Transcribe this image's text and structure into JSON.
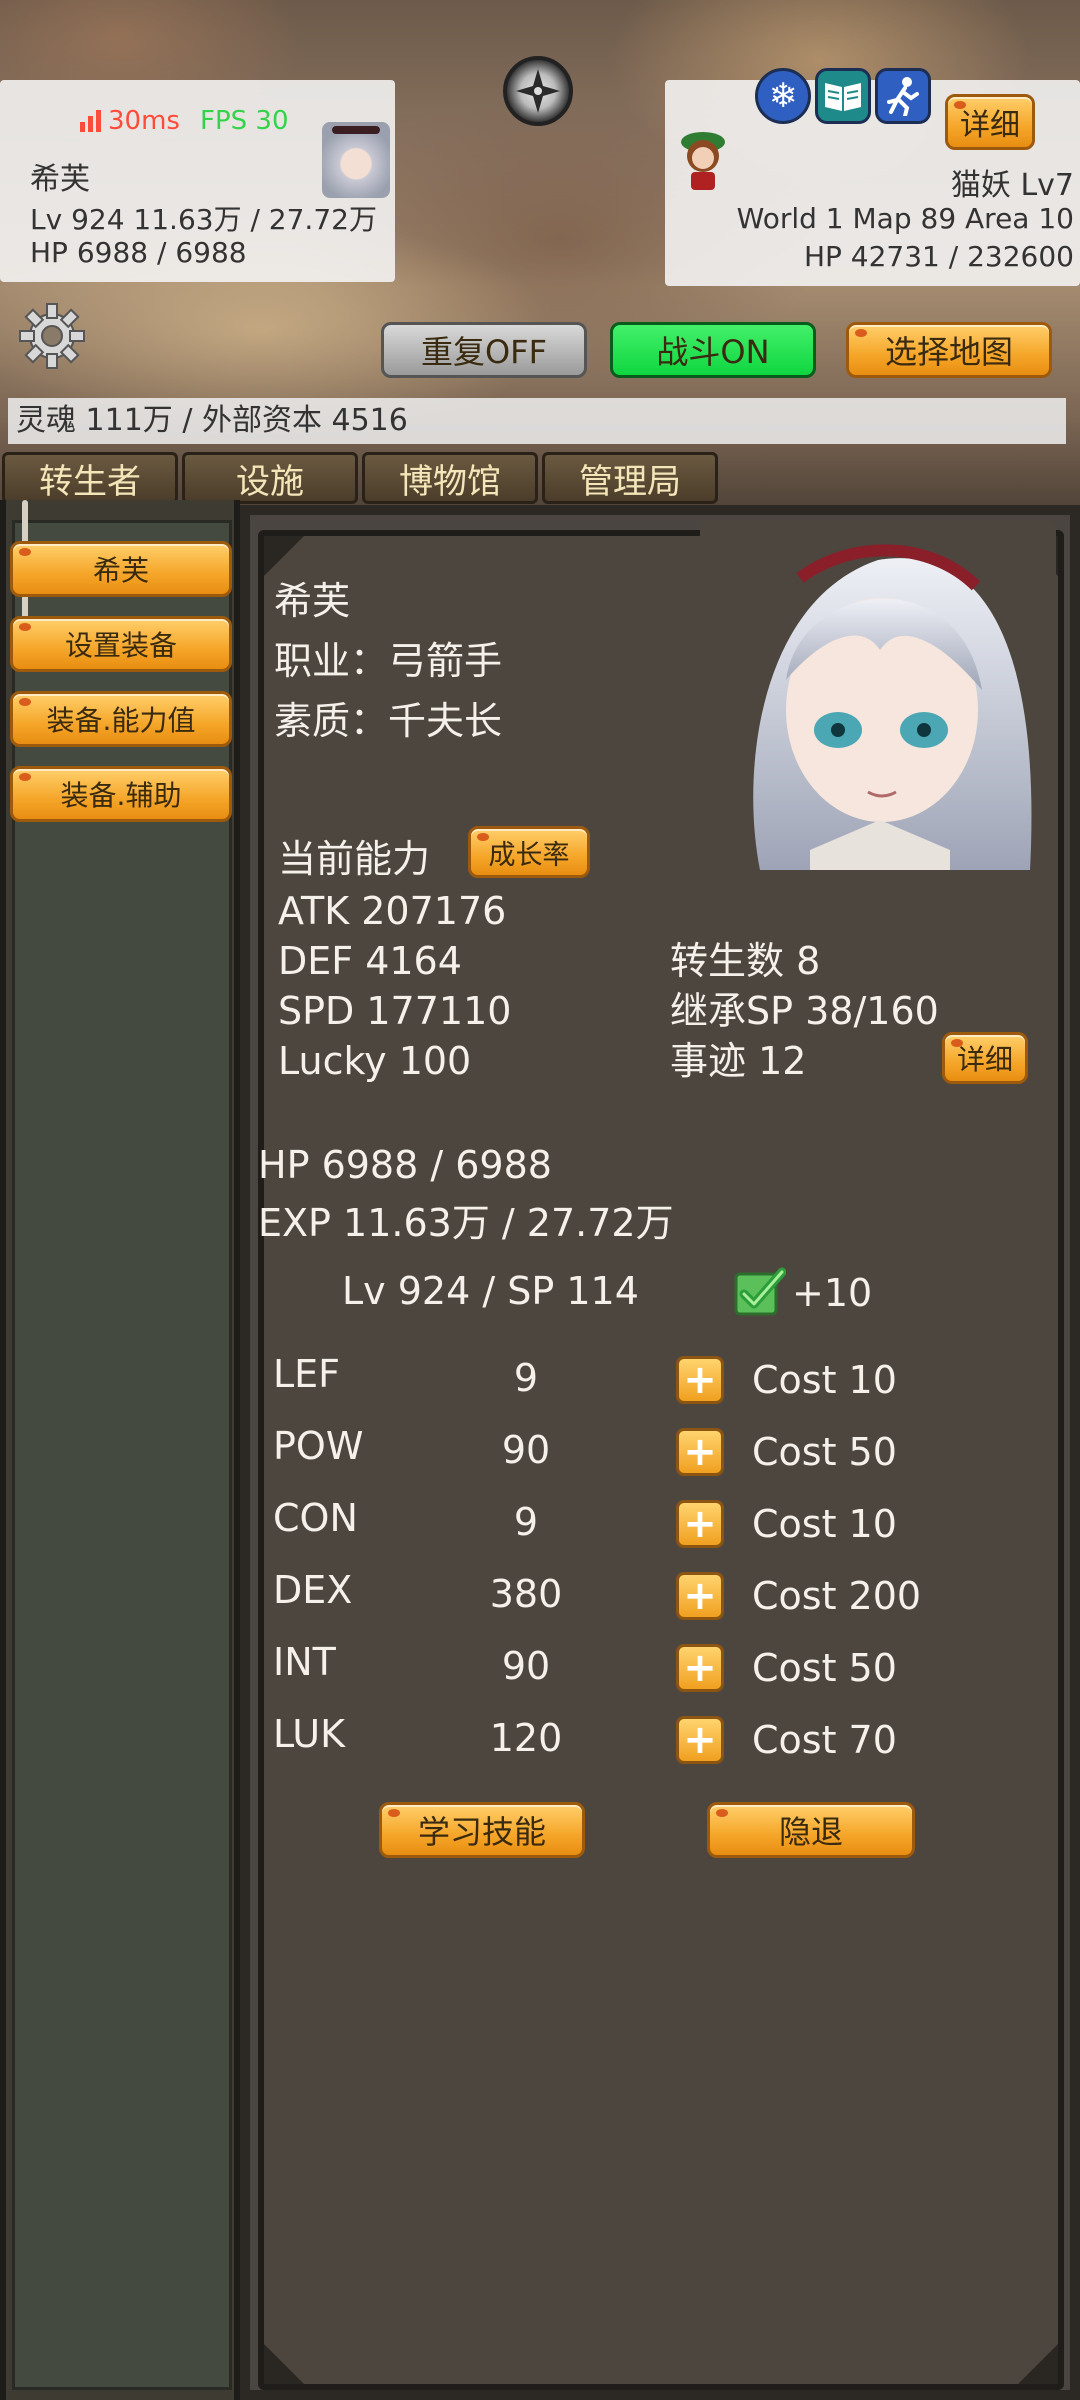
{
  "status": {
    "ping": "30ms",
    "fps": "FPS 30"
  },
  "player": {
    "name": "希芙",
    "lv": "Lv 924 11.63万 / 27.72万",
    "hp": "HP 6988 / 6988"
  },
  "enemy": {
    "name": "猫妖 Lv7",
    "location": "World 1 Map 89 Area 10",
    "hp": "HP 42731 / 232600",
    "detail_label": "详细"
  },
  "controls": {
    "repeat": "重复OFF",
    "battle": "战斗ON",
    "map": "选择地图"
  },
  "resources": "灵魂 111万 / 外部资本 4516",
  "tabs": [
    "转生者",
    "设施",
    "博物馆",
    "管理局"
  ],
  "sidebar": [
    "希芙",
    "设置装备",
    "装备.能力值",
    "装备.辅助"
  ],
  "profile": {
    "name": "希芙",
    "job": "职业：弓箭手",
    "quality": "素质：千夫长"
  },
  "ability": {
    "title": "当前能力",
    "growth_label": "成长率",
    "atk": "ATK 207176",
    "def": "DEF 4164",
    "spd": "SPD 177110",
    "lucky": "Lucky 100",
    "rebirth": "转生数 8",
    "inherit": "继承SP 38/160",
    "deeds": "事迹 12",
    "detail_label": "详细"
  },
  "vitals": {
    "hp": "HP 6988 / 6988",
    "exp": "EXP 11.63万 / 27.72万",
    "lvsp": "Lv 924 / SP 114",
    "increment": "+10"
  },
  "stats": [
    {
      "name": "LEF",
      "value": "9",
      "cost": "Cost 10"
    },
    {
      "name": "POW",
      "value": "90",
      "cost": "Cost 50"
    },
    {
      "name": "CON",
      "value": "9",
      "cost": "Cost 10"
    },
    {
      "name": "DEX",
      "value": "380",
      "cost": "Cost 200"
    },
    {
      "name": "INT",
      "value": "90",
      "cost": "Cost 50"
    },
    {
      "name": "LUK",
      "value": "120",
      "cost": "Cost 70"
    }
  ],
  "actions": {
    "learn": "学习技能",
    "retire": "隐退"
  },
  "colors": {
    "orange": "#f5a629",
    "green": "#0fd640",
    "panel": "#4c463f",
    "ping": "#ff4b3a",
    "fps": "#35d34a"
  }
}
